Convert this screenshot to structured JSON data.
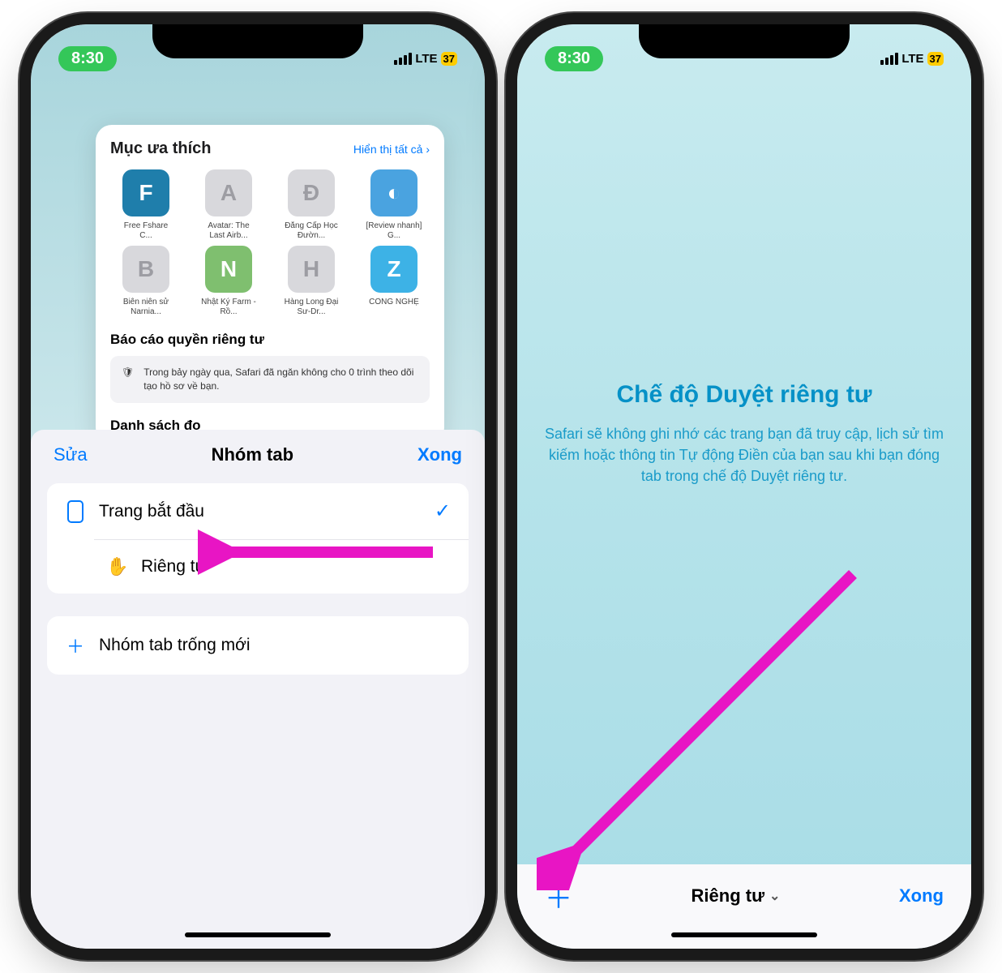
{
  "status": {
    "time": "8:30",
    "network": "LTE",
    "battery": "37"
  },
  "left": {
    "favorites": {
      "title": "Mục ưa thích",
      "show_all": "Hiển thị tất cả",
      "items": [
        {
          "glyph": "F",
          "color": "#1f7eab",
          "label": "Free Fshare C..."
        },
        {
          "glyph": "A",
          "color": "#d8d8dc",
          "label": "Avatar: The Last Airb..."
        },
        {
          "glyph": "Đ",
          "color": "#d8d8dc",
          "label": "Đẳng Cấp Học Đườn..."
        },
        {
          "glyph": "◐",
          "color": "#4aa3e0",
          "label": "[Review nhanh] G..."
        },
        {
          "glyph": "B",
          "color": "#d8d8dc",
          "label": "Biên niên sử Narnia..."
        },
        {
          "glyph": "N",
          "color": "#7fbf6f",
          "label": "Nhật Ký Farm - Rồ..."
        },
        {
          "glyph": "H",
          "color": "#d8d8dc",
          "label": "Hàng Long Đại Sư-Dr..."
        },
        {
          "glyph": "Z",
          "color": "#3db2e6",
          "label": "CÔNG NGHỆ"
        }
      ]
    },
    "privacy_report": {
      "title": "Báo cáo quyền riêng tư",
      "body": "Trong bảy ngày qua, Safari đã ngăn không cho 0 trình theo dõi tạo hồ sơ về bạn."
    },
    "reading_cut": "Danh sách đọc",
    "sheet": {
      "edit": "Sửa",
      "title": "Nhóm tab",
      "done": "Xong",
      "rows": {
        "start": "Trang bắt đầu",
        "private": "Riêng tư",
        "newgroup": "Nhóm tab trống mới"
      }
    }
  },
  "right": {
    "hero_title": "Chế độ Duyệt riêng tư",
    "hero_body": "Safari sẽ không ghi nhớ các trang bạn đã truy cập, lịch sử tìm kiếm hoặc thông tin Tự động Điền của bạn sau khi bạn đóng tab trong chế độ Duyệt riêng tư.",
    "bottom": {
      "mode": "Riêng tư",
      "done": "Xong"
    }
  }
}
